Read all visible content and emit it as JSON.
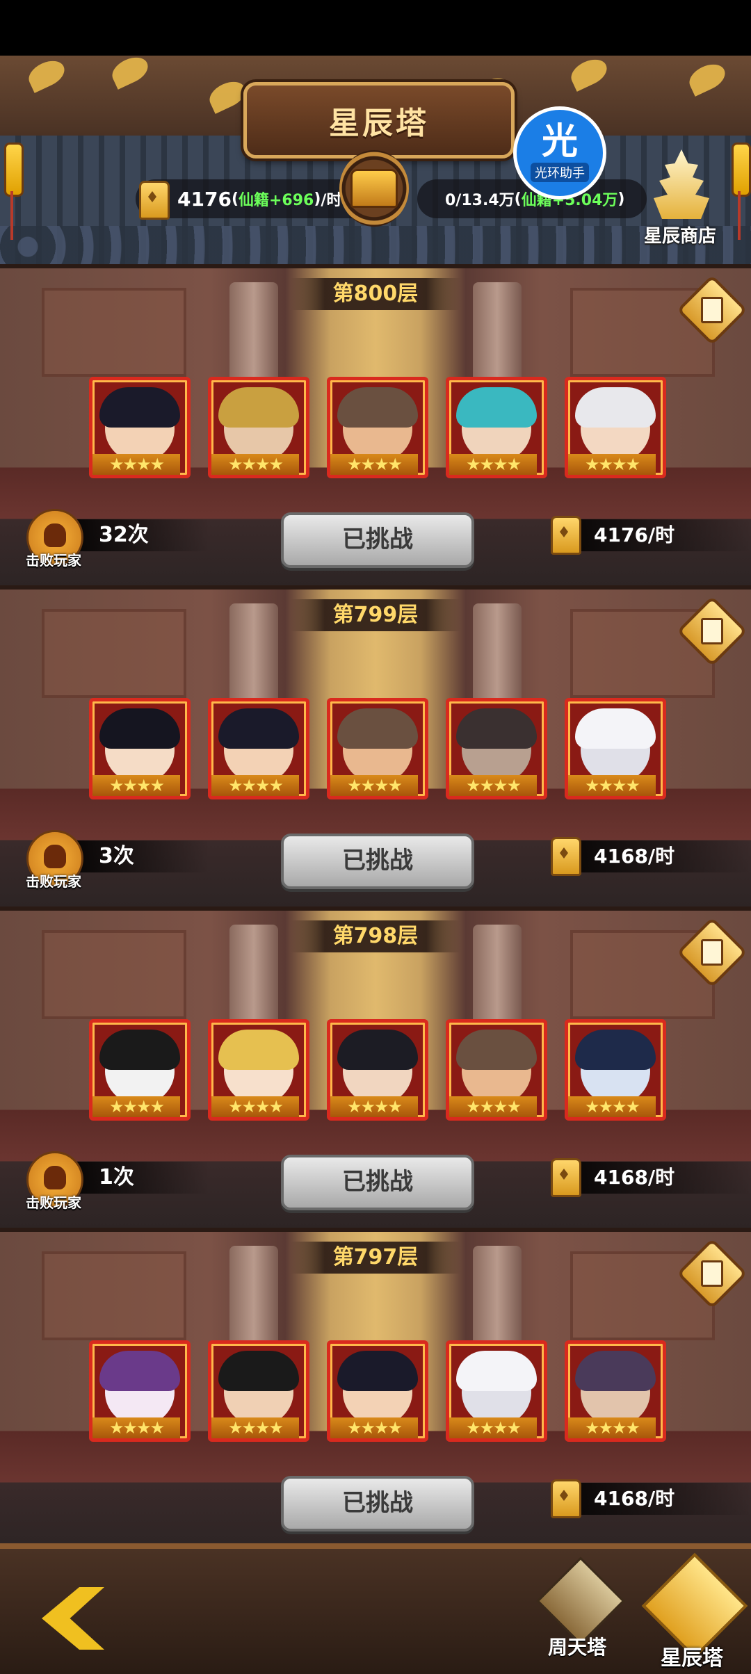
{
  "header": {
    "title": "星辰塔",
    "left_resource": {
      "value": "4176",
      "bonus_open": "(",
      "bonus": "仙籍+696",
      "bonus_close": ")",
      "unit": "/时"
    },
    "right_resource": {
      "value": "0/13.4万",
      "bonus_open": "(",
      "bonus": "仙籍+5.04万",
      "bonus_close": ")"
    },
    "helper_badge": {
      "glyph": "光",
      "label": "光环助手"
    },
    "shop_label": "星辰商店"
  },
  "colors": {
    "accent_gold": "#ffd86a",
    "bonus_green": "#6cff5a",
    "frame_red": "#d92a1e"
  },
  "floors": [
    {
      "title": "第800层",
      "defeat_count": "32次",
      "defeat_label": "击败玩家",
      "button": "已挑战",
      "rate": "4176/时",
      "heroes": [
        {
          "stars": "★★★★",
          "hair": "#1a1a2a",
          "face": "#f3d2b5"
        },
        {
          "stars": "★★★★",
          "hair": "#c9a040",
          "face": "#e7c7a8"
        },
        {
          "stars": "★★★★",
          "hair": "#6a5040",
          "face": "#e9b88f"
        },
        {
          "stars": "★★★★",
          "hair": "#3ab8c0",
          "face": "#f0d4bc"
        },
        {
          "stars": "★★★★",
          "hair": "#e8e8ec",
          "face": "#f3d8c2"
        }
      ]
    },
    {
      "title": "第799层",
      "defeat_count": "3次",
      "defeat_label": "击败玩家",
      "button": "已挑战",
      "rate": "4168/时",
      "heroes": [
        {
          "stars": "★★★★",
          "hair": "#151520",
          "face": "#f5dcc6"
        },
        {
          "stars": "★★★★",
          "hair": "#1a1a2a",
          "face": "#f3d2b5"
        },
        {
          "stars": "★★★★",
          "hair": "#6a5040",
          "face": "#e9b88f"
        },
        {
          "stars": "★★★★",
          "hair": "#3a3030",
          "face": "#b8a090"
        },
        {
          "stars": "★★★★",
          "hair": "#f4f4f8",
          "face": "#e0e0e8"
        }
      ]
    },
    {
      "title": "第798层",
      "defeat_count": "1次",
      "defeat_label": "击败玩家",
      "button": "已挑战",
      "rate": "4168/时",
      "heroes": [
        {
          "stars": "★★★★",
          "hair": "#1a1a1a",
          "face": "#f2f2f2"
        },
        {
          "stars": "★★★★",
          "hair": "#e6c050",
          "face": "#f7e0cc"
        },
        {
          "stars": "★★★★",
          "hair": "#1c1c24",
          "face": "#f1d6c0"
        },
        {
          "stars": "★★★★",
          "hair": "#6a5040",
          "face": "#e9b88f"
        },
        {
          "stars": "★★★★",
          "hair": "#1e2a4a",
          "face": "#d8e2f2"
        }
      ]
    },
    {
      "title": "第797层",
      "defeat_count": "",
      "defeat_label": "",
      "button": "已挑战",
      "rate": "4168/时",
      "heroes": [
        {
          "stars": "★★★★",
          "hair": "#6a3a8a",
          "face": "#f4e8f4"
        },
        {
          "stars": "★★★★",
          "hair": "#1a1a1a",
          "face": "#f0d0b4"
        },
        {
          "stars": "★★★★",
          "hair": "#1a1a2a",
          "face": "#f3d2b5"
        },
        {
          "stars": "★★★★",
          "hair": "#f4f4f8",
          "face": "#e0e0e8"
        },
        {
          "stars": "★★★★",
          "hair": "#4a3a5a",
          "face": "#e2c4ac"
        }
      ]
    }
  ],
  "bottom_nav": {
    "zhoutian_label": "周天塔",
    "xingchen_label": "星辰塔"
  },
  "icons": {
    "back": "back-arrow-icon",
    "doc": "document-icon",
    "skull": "skull-icon",
    "token": "token-icon",
    "chest": "treasure-chest-icon"
  }
}
